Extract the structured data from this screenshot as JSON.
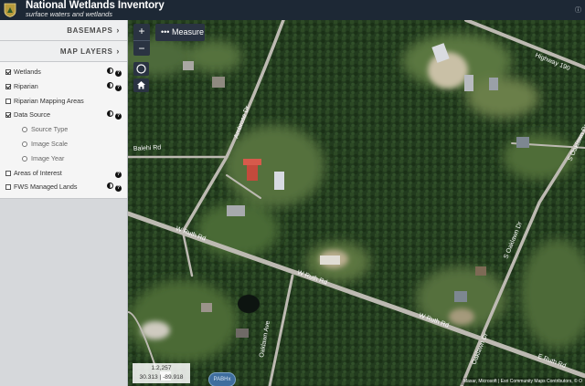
{
  "header": {
    "title": "National Wetlands Inventory",
    "subtitle": "surface waters and wetlands"
  },
  "sidebar": {
    "basemaps_label": "BASEMAPS",
    "map_layers_label": "MAP LAYERS",
    "layers": [
      {
        "label": "Wetlands",
        "checked": true
      },
      {
        "label": "Riparian",
        "checked": true
      },
      {
        "label": "Riparian Mapping Areas",
        "checked": false
      },
      {
        "label": "Data Source",
        "checked": true
      },
      {
        "label": "Source Type",
        "sub": true
      },
      {
        "label": "Image Scale",
        "sub": true
      },
      {
        "label": "Image Year",
        "sub": true
      },
      {
        "label": "Areas of Interest",
        "checked": false
      },
      {
        "label": "FWS Managed Lands",
        "checked": false
      }
    ]
  },
  "map_controls": {
    "zoom_in": "+",
    "zoom_out": "−",
    "measure_label": "Measure",
    "measure_icon": "dots-icon"
  },
  "scale": {
    "ratio": "1:2,257",
    "coords": "30.313 | -89.918"
  },
  "attribution": "Maxar, Microsoft | Esri Community Maps Contributors, © O",
  "badge": "PABHx",
  "roads": {
    "highway": "Highway 190",
    "ambrose": "Ambrose Dr",
    "balehi": "Balehi Rd",
    "w_ruth_1": "W Ruth Rd",
    "w_ruth_2": "W Ruth Rd",
    "w_ruth_3": "W Ruth Rd",
    "e_ruth": "E Ruth Rd",
    "oaklawn_1": "S Oaklawn Dr",
    "oaklawn_2": "S Oaklawn Dr",
    "oaklawn_3": "Oaklawn Dr",
    "oaklawn_ave": "Oaklawn Ave"
  },
  "colors": {
    "header_bg": "#1d2835",
    "sidebar_bg": "#d6d8db",
    "control_bg": "#2a3342",
    "forest": "#213a1d",
    "road": "#bdbab2"
  }
}
